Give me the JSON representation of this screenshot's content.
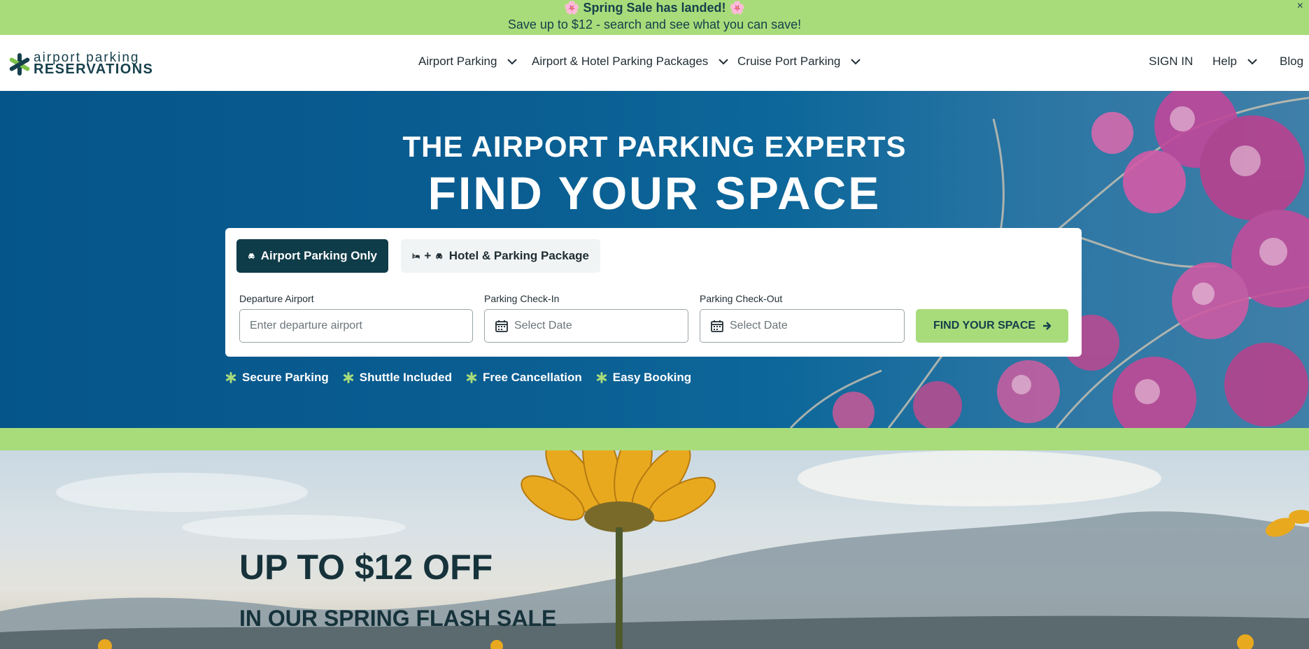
{
  "promo": {
    "title": "Spring Sale has landed!",
    "emoji": "🌸",
    "subtitle": "Save up to $12 - search and see what you can save!",
    "close": "×",
    "bg_color": "#a8dc7a"
  },
  "header": {
    "logo_top": "airport parking",
    "logo_bottom": "RESERVATIONS",
    "nav": [
      {
        "label": "Airport Parking"
      },
      {
        "label": "Airport & Hotel Parking Packages"
      },
      {
        "label": "Cruise Port Parking"
      }
    ],
    "sign_in": "SIGN IN",
    "help": "Help",
    "blog": "Blog"
  },
  "hero": {
    "kicker": "THE AIRPORT PARKING EXPERTS",
    "title": "FIND YOUR SPACE",
    "tabs": {
      "active": "Airport Parking Only",
      "inactive": "Hotel & Parking Package",
      "plus": "+"
    },
    "fields": {
      "departure_label": "Departure Airport",
      "departure_placeholder": "Enter departure airport",
      "checkin_label": "Parking Check-In",
      "checkin_placeholder": "Select Date",
      "checkout_label": "Parking Check-Out",
      "checkout_placeholder": "Select Date"
    },
    "find_button": "FIND YOUR SPACE",
    "features": [
      "Secure Parking",
      "Shuttle Included",
      "Free Cancellation",
      "Easy Booking"
    ]
  },
  "sale": {
    "title": "UP TO $12 OFF",
    "subtitle": "IN OUR SPRING FLASH SALE"
  },
  "colors": {
    "brand_dark": "#0f3c49",
    "brand_green": "#a8dc7a",
    "hero_blue": "#05558a"
  }
}
